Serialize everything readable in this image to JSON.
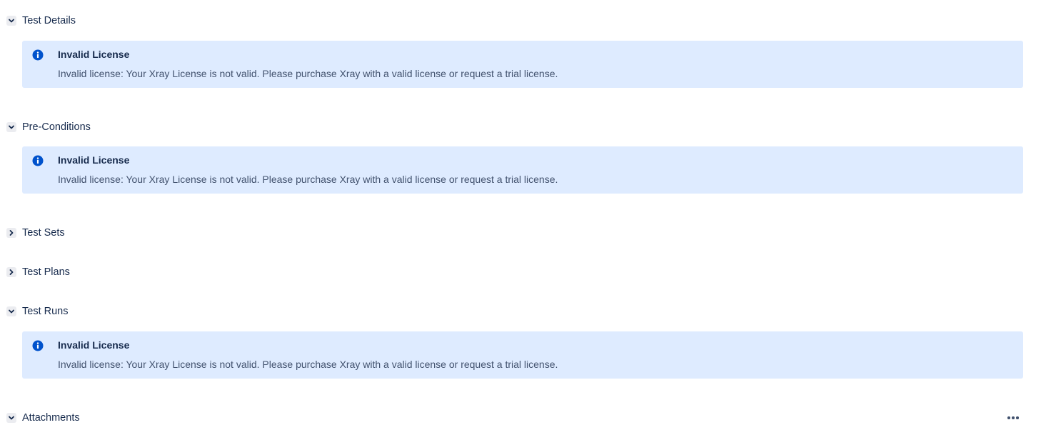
{
  "sections": [
    {
      "title": "Test Details",
      "expanded": true,
      "banner": {
        "title": "Invalid License",
        "message": "Invalid license: Your Xray License is not valid. Please purchase Xray with a valid license or request a trial license."
      }
    },
    {
      "title": "Pre-Conditions",
      "expanded": true,
      "banner": {
        "title": "Invalid License",
        "message": "Invalid license: Your Xray License is not valid. Please purchase Xray with a valid license or request a trial license."
      }
    },
    {
      "title": "Test Sets",
      "expanded": false
    },
    {
      "title": "Test Plans",
      "expanded": false
    },
    {
      "title": "Test Runs",
      "expanded": true,
      "banner": {
        "title": "Invalid License",
        "message": "Invalid license: Your Xray License is not valid. Please purchase Xray with a valid license or request a trial license."
      }
    },
    {
      "title": "Attachments",
      "expanded": true
    }
  ],
  "icons": {
    "expanded": "chevron-down-icon",
    "collapsed": "chevron-right-icon",
    "info": "info-icon",
    "more": "more-icon"
  },
  "colors": {
    "banner_background": "#deebff",
    "info_icon": "#0052cc",
    "text": "#172b4d"
  }
}
